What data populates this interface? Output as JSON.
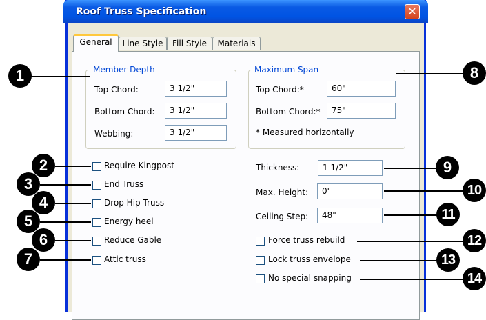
{
  "dialog": {
    "title": "Roof Truss Specification",
    "close_symbol": "✕"
  },
  "tabs": [
    {
      "label": "General",
      "active": true
    },
    {
      "label": "Line Style"
    },
    {
      "label": "Fill Style"
    },
    {
      "label": "Materials"
    }
  ],
  "member_depth": {
    "legend": "Member Depth",
    "top_chord": {
      "label": "Top Chord:",
      "value": "3 1/2\""
    },
    "bottom_chord": {
      "label": "Bottom Chord:",
      "value": "3 1/2\""
    },
    "webbing": {
      "label": "Webbing:",
      "value": "3 1/2\""
    }
  },
  "maximum_span": {
    "legend": "Maximum Span",
    "top_chord": {
      "label": "Top Chord:*",
      "value": "60\""
    },
    "bottom_chord": {
      "label": "Bottom Chord:*",
      "value": "75\""
    },
    "note": "* Measured horizontally"
  },
  "checkboxes_left": [
    {
      "label": "Require Kingpost",
      "checked": false
    },
    {
      "label": "End Truss",
      "checked": false
    },
    {
      "label": "Drop Hip Truss",
      "checked": false
    },
    {
      "label": "Energy heel",
      "checked": false
    },
    {
      "label": "Reduce Gable",
      "checked": false
    },
    {
      "label": "Attic truss",
      "checked": false
    }
  ],
  "right_fields": {
    "thickness": {
      "label": "Thickness:",
      "value": "1 1/2\""
    },
    "max_height": {
      "label": "Max. Height:",
      "value": "0\""
    },
    "ceiling_step": {
      "label": "Ceiling Step:",
      "value": "48\""
    }
  },
  "checkboxes_right": [
    {
      "label": "Force truss rebuild",
      "checked": false
    },
    {
      "label": "Lock truss envelope",
      "checked": false
    },
    {
      "label": "No special snapping",
      "checked": false
    }
  ],
  "callouts": [
    "1",
    "2",
    "3",
    "4",
    "5",
    "6",
    "7",
    "8",
    "9",
    "10",
    "11",
    "12",
    "13",
    "14"
  ]
}
